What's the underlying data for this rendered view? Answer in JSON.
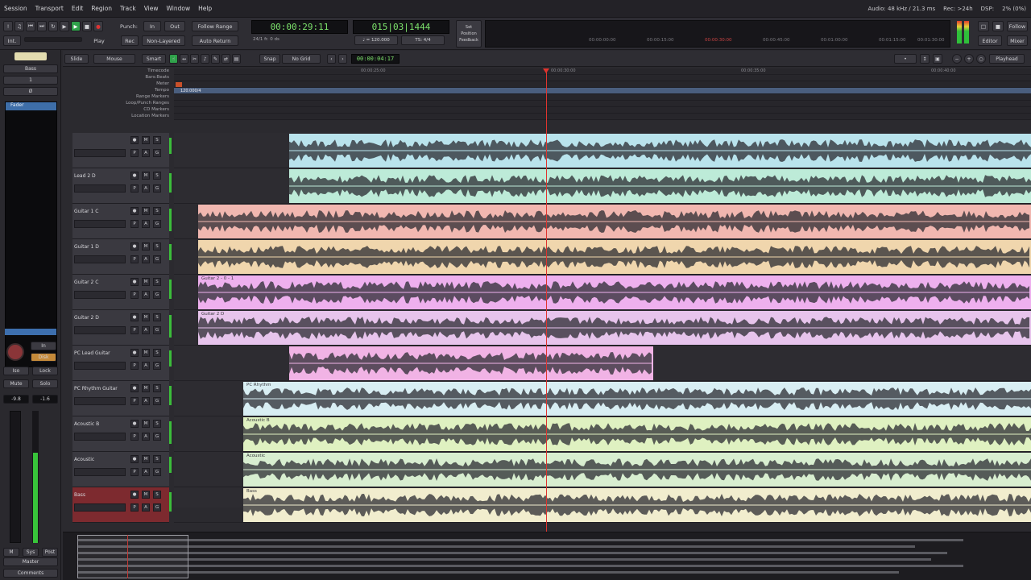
{
  "menubar": {
    "items": [
      "Session",
      "Transport",
      "Edit",
      "Region",
      "Track",
      "View",
      "Window",
      "Help"
    ],
    "status": [
      "Audio: 48 kHz / 21.3 ms",
      "Rec: >24h",
      "DSP:",
      "2% (0%)"
    ]
  },
  "transport": {
    "int_label": "Int.",
    "play_label": "Play",
    "punch_label": "Punch:",
    "in_label": "In",
    "out_label": "Out",
    "rec_label": "Rec",
    "non_layered_label": "Non-Layered",
    "follow_range_label": "Follow Range",
    "auto_return_label": "Auto Return",
    "primary_clock": "00:00:29:11",
    "primary_sub": "24/1 fr. 0 ds",
    "secondary_clock": "015|03|1444",
    "secondary_sub1": "♩ = 120.000",
    "secondary_sub2": "TS: 4/4",
    "mini_timeline_ticks": [
      "00:00:00:00",
      "00:00:15:00",
      "00:00:30:00",
      "00:00:45:00",
      "00:01:00:00",
      "00:01:15:00",
      "00:01:30:00"
    ],
    "follow_label": "Follow",
    "mixer_label": "Mixer",
    "editor_label": "Editor",
    "set_position_feedback": [
      "Set",
      "Position",
      "Feedback"
    ]
  },
  "edittools": {
    "slide_label": "Slide",
    "mouse_label": "Mouse",
    "smart_label": "Smart",
    "snap_label": "Snap",
    "no_grid_label": "No Grid",
    "nudge_clock": "00:00:04:17",
    "playhead_label": "Playhead"
  },
  "strip": {
    "bass_label": "Bass",
    "plugin_label": "Fader",
    "in_label": "In",
    "disk_label": "Disk",
    "iso_label": "Iso",
    "lock_label": "Lock",
    "mute_label": "Mute",
    "solo_label": "Solo",
    "gain_value": "-9.8",
    "peak_value": "-1.6",
    "bottom_labels": [
      "M",
      "Sys",
      "Post"
    ],
    "master_label": "Master",
    "comments_label": "Comments"
  },
  "rulers": [
    {
      "label": "Timecode"
    },
    {
      "label": "Bars:Beats"
    },
    {
      "label": "Meter"
    },
    {
      "label": "Tempo",
      "value": "120.000/4"
    },
    {
      "label": "Range Markers"
    },
    {
      "label": "Loop/Punch Ranges"
    },
    {
      "label": "CD Markers"
    },
    {
      "label": "Location Markers"
    }
  ],
  "ruler_ticks": [
    "00:00:25:00",
    "00:00:30:00",
    "00:00:35:00",
    "00:00:40:00"
  ],
  "tracks": [
    {
      "name": "",
      "color": "#b9e3ec",
      "regions": [
        {
          "start": 143,
          "width": 921,
          "name": ""
        }
      ]
    },
    {
      "name": "Lead 2 D",
      "color": "#bdebd8",
      "regions": [
        {
          "start": 143,
          "width": 921,
          "name": ""
        }
      ]
    },
    {
      "name": "Guitar 1 C",
      "color": "#f1b7b0",
      "regions": [
        {
          "start": 30,
          "width": 1034,
          "name": ""
        }
      ]
    },
    {
      "name": "Guitar 1 D",
      "color": "#f0d6ad",
      "regions": [
        {
          "start": 30,
          "width": 1034,
          "name": ""
        }
      ]
    },
    {
      "name": "Guitar 2 C",
      "color": "#eeb0ee",
      "regions": [
        {
          "start": 30,
          "width": 1034,
          "name": "Guitar 2 - 0 - 1"
        }
      ]
    },
    {
      "name": "Guitar 2 D",
      "color": "#e7c4ec",
      "regions": [
        {
          "start": 30,
          "width": 1034,
          "name": "Guitar 2 D"
        }
      ]
    },
    {
      "name": "PC Lead Guitar",
      "color": "#f1b3e5",
      "regions": [
        {
          "start": 143,
          "width": 452,
          "name": ""
        }
      ]
    },
    {
      "name": "PC Rhythm Guitar",
      "color": "#d8eef3",
      "regions": [
        {
          "start": 86,
          "width": 978,
          "name": "PC Rhythm"
        }
      ]
    },
    {
      "name": "Acoustic B",
      "color": "#dff1c1",
      "regions": [
        {
          "start": 86,
          "width": 978,
          "name": "Acoustic B"
        }
      ]
    },
    {
      "name": "Acoustic",
      "color": "#d8eed0",
      "regions": [
        {
          "start": 86,
          "width": 978,
          "name": "Acoustic"
        }
      ]
    },
    {
      "name": "Bass",
      "color": "#f1edce",
      "selected": true,
      "regions": [
        {
          "start": 86,
          "width": 978,
          "name": "Bass"
        }
      ]
    }
  ]
}
